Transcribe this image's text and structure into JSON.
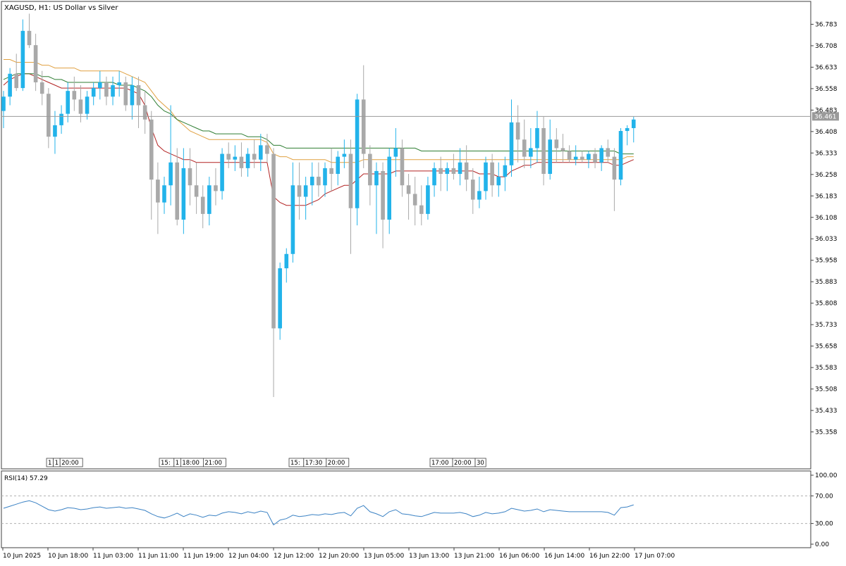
{
  "symbol_title": "XAGUSD, H1:  US Dollar vs Silver",
  "current_price_label": "36.461",
  "rsi_label": "RSI(14) 57.29",
  "colors": {
    "bull": "#22b3ea",
    "bear": "#a9a9a9",
    "ma_fast": "#b22222",
    "ma_mid": "#e0a040",
    "ma_slow": "#2e7d32",
    "rsi_line": "#3b82c4",
    "price_line": "#9a9a9a",
    "frame": "#404040",
    "text": "#000000"
  },
  "chart_data": {
    "type": "candlestick",
    "title": "XAGUSD, H1:  US Dollar vs Silver",
    "ylim": [
      35.283,
      36.858
    ],
    "y_ticks": [
      "36.783",
      "36.708",
      "36.633",
      "36.558",
      "36.483",
      "36.408",
      "36.333",
      "36.258",
      "36.183",
      "36.108",
      "36.033",
      "35.958",
      "35.883",
      "35.808",
      "35.733",
      "35.658",
      "35.583",
      "35.508",
      "35.433",
      "35.358"
    ],
    "x_ticks": [
      "10 Jun 2025",
      "10 Jun 18:00",
      "11 Jun 03:00",
      "11 Jun 11:00",
      "11 Jun 19:00",
      "12 Jun 04:00",
      "12 Jun 12:00",
      "12 Jun 20:00",
      "13 Jun 05:00",
      "13 Jun 13:00",
      "13 Jun 21:00",
      "16 Jun 06:00",
      "16 Jun 14:00",
      "16 Jun 22:00",
      "17 Jun 07:00"
    ],
    "current_price": 36.461,
    "grid": false,
    "event_markers": [
      {
        "group": 1,
        "labels": [
          "1",
          "1",
          "20:00"
        ]
      },
      {
        "group": 2,
        "labels": [
          "15:",
          "1",
          "18:00",
          "21:00"
        ]
      },
      {
        "group": 3,
        "labels": [
          "15:",
          "17:30",
          "20:00"
        ]
      },
      {
        "group": 4,
        "labels": [
          "17:00",
          "20:00",
          "30"
        ]
      }
    ],
    "candles": [
      [
        36.48,
        36.55,
        36.42,
        36.53
      ],
      [
        36.53,
        36.63,
        36.5,
        36.61
      ],
      [
        36.61,
        36.68,
        36.55,
        36.56
      ],
      [
        36.56,
        36.8,
        36.55,
        36.76
      ],
      [
        36.76,
        36.82,
        36.7,
        36.71
      ],
      [
        36.71,
        36.75,
        36.55,
        36.58
      ],
      [
        36.58,
        36.62,
        36.5,
        36.54
      ],
      [
        36.54,
        36.56,
        36.35,
        36.39
      ],
      [
        36.39,
        36.48,
        36.33,
        36.43
      ],
      [
        36.43,
        36.5,
        36.4,
        36.47
      ],
      [
        36.47,
        36.58,
        36.44,
        36.55
      ],
      [
        36.55,
        36.6,
        36.48,
        36.52
      ],
      [
        36.52,
        36.57,
        36.44,
        36.47
      ],
      [
        36.47,
        36.55,
        36.45,
        36.53
      ],
      [
        36.53,
        36.58,
        36.5,
        36.56
      ],
      [
        36.56,
        36.62,
        36.52,
        36.58
      ],
      [
        36.58,
        36.6,
        36.5,
        36.53
      ],
      [
        36.53,
        36.6,
        36.5,
        36.57
      ],
      [
        36.57,
        36.62,
        36.53,
        36.58
      ],
      [
        36.58,
        36.6,
        36.48,
        36.5
      ],
      [
        36.5,
        36.6,
        36.45,
        36.57
      ],
      [
        36.57,
        36.6,
        36.42,
        36.5
      ],
      [
        36.5,
        36.55,
        36.4,
        36.45
      ],
      [
        36.45,
        36.48,
        36.1,
        36.24
      ],
      [
        36.24,
        36.3,
        36.05,
        36.16
      ],
      [
        36.16,
        36.25,
        36.12,
        36.22
      ],
      [
        36.22,
        36.5,
        36.15,
        36.3
      ],
      [
        36.3,
        36.35,
        36.08,
        36.1
      ],
      [
        36.1,
        36.35,
        36.05,
        36.28
      ],
      [
        36.28,
        36.35,
        36.15,
        36.22
      ],
      [
        36.22,
        36.3,
        36.12,
        36.18
      ],
      [
        36.18,
        36.22,
        36.07,
        36.12
      ],
      [
        36.12,
        36.25,
        36.08,
        36.22
      ],
      [
        36.22,
        36.28,
        36.15,
        36.2
      ],
      [
        36.2,
        36.35,
        36.17,
        36.33
      ],
      [
        36.33,
        36.37,
        36.28,
        36.31
      ],
      [
        36.31,
        36.36,
        36.27,
        36.32
      ],
      [
        36.32,
        36.37,
        36.25,
        36.28
      ],
      [
        36.28,
        36.35,
        36.25,
        36.33
      ],
      [
        36.33,
        36.38,
        36.28,
        36.31
      ],
      [
        36.31,
        36.4,
        36.27,
        36.36
      ],
      [
        36.36,
        36.4,
        36.3,
        36.33
      ],
      [
        36.33,
        36.35,
        35.48,
        35.72
      ],
      [
        35.72,
        35.95,
        35.68,
        35.93
      ],
      [
        35.93,
        36.0,
        35.88,
        35.98
      ],
      [
        35.98,
        36.3,
        35.95,
        36.22
      ],
      [
        36.22,
        36.3,
        36.1,
        36.18
      ],
      [
        36.18,
        36.25,
        36.1,
        36.22
      ],
      [
        36.22,
        36.3,
        36.15,
        36.25
      ],
      [
        36.25,
        36.3,
        36.18,
        36.22
      ],
      [
        36.22,
        36.3,
        36.18,
        36.28
      ],
      [
        36.28,
        36.35,
        36.2,
        36.26
      ],
      [
        36.26,
        36.34,
        36.22,
        36.32
      ],
      [
        36.32,
        36.38,
        36.28,
        36.33
      ],
      [
        36.33,
        36.38,
        35.98,
        36.14
      ],
      [
        36.14,
        36.54,
        36.08,
        36.52
      ],
      [
        36.52,
        36.64,
        36.28,
        36.33
      ],
      [
        36.33,
        36.36,
        36.15,
        36.22
      ],
      [
        36.22,
        36.3,
        36.05,
        36.27
      ],
      [
        36.27,
        36.3,
        36.0,
        36.1
      ],
      [
        36.1,
        36.35,
        36.05,
        36.32
      ],
      [
        36.32,
        36.42,
        36.25,
        36.35
      ],
      [
        36.35,
        36.38,
        36.18,
        36.22
      ],
      [
        36.22,
        36.26,
        36.1,
        36.19
      ],
      [
        36.19,
        36.25,
        36.08,
        36.15
      ],
      [
        36.15,
        36.22,
        36.08,
        36.12
      ],
      [
        36.12,
        36.25,
        36.1,
        36.22
      ],
      [
        36.22,
        36.3,
        36.18,
        36.28
      ],
      [
        36.28,
        36.32,
        36.2,
        36.26
      ],
      [
        36.26,
        36.3,
        36.2,
        36.28
      ],
      [
        36.28,
        36.33,
        36.24,
        36.26
      ],
      [
        36.26,
        36.35,
        36.22,
        36.3
      ],
      [
        36.3,
        36.36,
        36.2,
        36.24
      ],
      [
        36.24,
        36.28,
        36.12,
        36.17
      ],
      [
        36.17,
        36.25,
        36.14,
        36.2
      ],
      [
        36.2,
        36.32,
        36.17,
        36.3
      ],
      [
        36.3,
        36.33,
        36.18,
        36.22
      ],
      [
        36.22,
        36.3,
        36.18,
        36.25
      ],
      [
        36.25,
        36.32,
        36.2,
        36.29
      ],
      [
        36.29,
        36.52,
        36.25,
        36.44
      ],
      [
        36.44,
        36.5,
        36.3,
        36.38
      ],
      [
        36.38,
        36.45,
        36.28,
        36.32
      ],
      [
        36.32,
        36.42,
        36.28,
        36.35
      ],
      [
        36.35,
        36.48,
        36.3,
        36.42
      ],
      [
        36.42,
        36.46,
        36.22,
        36.26
      ],
      [
        36.26,
        36.45,
        36.24,
        36.38
      ],
      [
        36.38,
        36.42,
        36.3,
        36.35
      ],
      [
        36.35,
        36.4,
        36.3,
        36.34
      ],
      [
        36.34,
        36.36,
        36.3,
        36.31
      ],
      [
        36.31,
        36.36,
        36.29,
        36.32
      ],
      [
        36.32,
        36.34,
        36.3,
        36.31
      ],
      [
        36.31,
        36.34,
        36.28,
        36.33
      ],
      [
        36.33,
        36.35,
        36.28,
        36.3
      ],
      [
        36.3,
        36.36,
        36.27,
        36.35
      ],
      [
        36.35,
        36.38,
        36.3,
        36.32
      ],
      [
        36.32,
        36.35,
        36.13,
        36.24
      ],
      [
        36.24,
        36.42,
        36.22,
        36.41
      ],
      [
        36.41,
        36.43,
        36.36,
        36.42
      ],
      [
        36.42,
        36.46,
        36.37,
        36.45
      ]
    ],
    "moving_averages": [
      {
        "values": [
          36.57,
          36.59,
          36.6,
          36.61,
          36.61,
          36.6,
          36.59,
          36.58,
          36.57,
          36.56,
          36.56,
          36.56,
          36.56,
          36.56,
          36.56,
          36.56,
          36.56,
          36.56,
          36.56,
          36.56,
          36.55,
          36.54,
          36.5,
          36.42,
          36.36,
          36.34,
          36.33,
          36.32,
          36.31,
          36.31,
          36.3,
          36.3,
          36.3,
          36.3,
          36.3,
          36.3,
          36.3,
          36.3,
          36.3,
          36.3,
          36.3,
          36.3,
          36.18,
          36.16,
          36.15,
          36.15,
          36.15,
          36.15,
          36.16,
          36.17,
          36.19,
          36.2,
          36.21,
          36.22,
          36.22,
          36.24,
          36.26,
          36.26,
          36.26,
          36.26,
          36.26,
          36.27,
          36.27,
          36.27,
          36.27,
          36.27,
          36.27,
          36.27,
          36.27,
          36.27,
          36.27,
          36.27,
          36.27,
          36.27,
          36.26,
          36.26,
          36.26,
          36.25,
          36.25,
          36.27,
          36.28,
          36.29,
          36.29,
          36.3,
          36.3,
          36.3,
          36.3,
          36.3,
          36.3,
          36.3,
          36.3,
          36.3,
          36.3,
          36.3,
          36.3,
          36.29,
          36.29,
          36.3,
          36.31
        ]
      },
      {
        "values": [
          36.66,
          36.66,
          36.65,
          36.65,
          36.65,
          36.65,
          36.64,
          36.64,
          36.63,
          36.63,
          36.63,
          36.63,
          36.62,
          36.62,
          36.62,
          36.62,
          36.62,
          36.62,
          36.62,
          36.61,
          36.6,
          36.59,
          36.58,
          36.55,
          36.52,
          36.5,
          36.48,
          36.45,
          36.43,
          36.41,
          36.4,
          36.39,
          36.38,
          36.38,
          36.38,
          36.38,
          36.38,
          36.38,
          36.38,
          36.38,
          36.38,
          36.37,
          36.33,
          36.32,
          36.32,
          36.31,
          36.31,
          36.31,
          36.31,
          36.31,
          36.31,
          36.3,
          36.3,
          36.3,
          36.3,
          36.3,
          36.31,
          36.31,
          36.31,
          36.31,
          36.31,
          36.31,
          36.31,
          36.31,
          36.31,
          36.31,
          36.31,
          36.31,
          36.31,
          36.31,
          36.31,
          36.31,
          36.31,
          36.31,
          36.31,
          36.31,
          36.31,
          36.31,
          36.31,
          36.31,
          36.31,
          36.31,
          36.31,
          36.31,
          36.31,
          36.31,
          36.31,
          36.31,
          36.31,
          36.31,
          36.31,
          36.31,
          36.31,
          36.31,
          36.31,
          36.31,
          36.31,
          36.32,
          36.32
        ]
      },
      {
        "values": [
          36.59,
          36.6,
          36.61,
          36.61,
          36.61,
          36.61,
          36.6,
          36.6,
          36.59,
          36.59,
          36.58,
          36.58,
          36.58,
          36.58,
          36.58,
          36.58,
          36.58,
          36.58,
          36.57,
          36.57,
          36.57,
          36.56,
          36.55,
          36.53,
          36.5,
          36.48,
          36.47,
          36.45,
          36.44,
          36.43,
          36.42,
          36.41,
          36.41,
          36.4,
          36.4,
          36.4,
          36.4,
          36.4,
          36.39,
          36.39,
          36.39,
          36.38,
          36.36,
          36.36,
          36.35,
          36.35,
          36.35,
          36.35,
          36.35,
          36.35,
          36.35,
          36.35,
          36.35,
          36.35,
          36.35,
          36.35,
          36.35,
          36.35,
          36.35,
          36.35,
          36.35,
          36.35,
          36.35,
          36.35,
          36.35,
          36.34,
          36.34,
          36.34,
          36.34,
          36.34,
          36.34,
          36.34,
          36.34,
          36.34,
          36.34,
          36.34,
          36.34,
          36.34,
          36.34,
          36.34,
          36.34,
          36.34,
          36.34,
          36.34,
          36.34,
          36.34,
          36.34,
          36.34,
          36.34,
          36.34,
          36.34,
          36.34,
          36.34,
          36.34,
          36.34,
          36.34,
          36.33,
          36.33,
          36.33
        ]
      }
    ],
    "rsi": {
      "label": "RSI(14) 57.29",
      "ylim": [
        0,
        100
      ],
      "y_ticks": [
        "100.00",
        "70.00",
        "30.00",
        "0.00"
      ],
      "levels": [
        70,
        30
      ],
      "values": [
        52,
        55,
        58,
        61,
        63,
        60,
        55,
        50,
        48,
        50,
        53,
        52,
        50,
        51,
        53,
        54,
        52,
        53,
        54,
        52,
        53,
        51,
        49,
        44,
        40,
        38,
        41,
        45,
        40,
        44,
        42,
        39,
        42,
        41,
        45,
        47,
        46,
        44,
        47,
        45,
        48,
        46,
        28,
        35,
        37,
        42,
        40,
        41,
        43,
        42,
        44,
        43,
        45,
        46,
        41,
        52,
        56,
        47,
        44,
        40,
        47,
        50,
        44,
        43,
        41,
        40,
        43,
        46,
        45,
        45,
        45,
        46,
        44,
        40,
        42,
        46,
        44,
        45,
        47,
        52,
        50,
        48,
        49,
        51,
        47,
        50,
        49,
        48,
        47,
        47,
        47,
        47,
        47,
        47,
        46,
        42,
        53,
        54,
        57
      ]
    }
  }
}
